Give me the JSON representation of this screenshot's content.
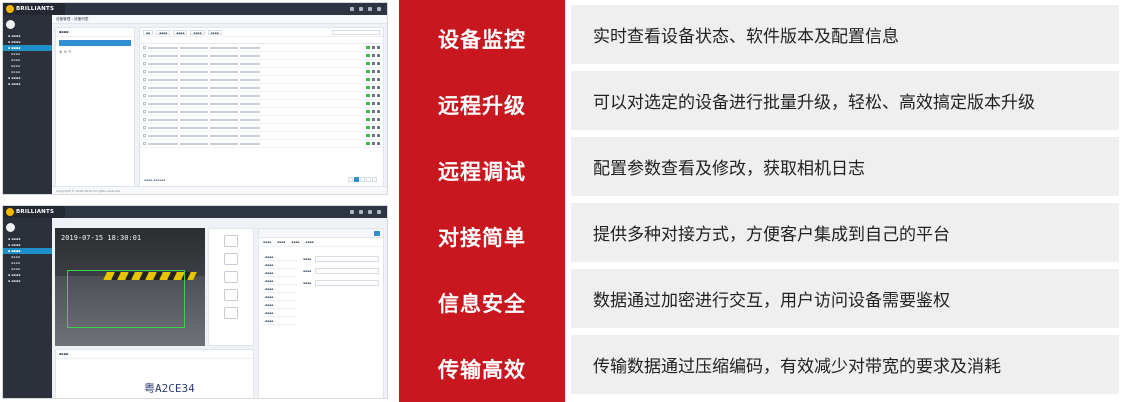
{
  "screenshot_top": {
    "brand": "BRILLIANTS",
    "breadcrumb": "设备管理 › 设备列表",
    "footer": "Copyright © 2018-2019 All rights reserved."
  },
  "screenshot_bottom": {
    "brand": "BRILLIANTS",
    "timestamp": "2019-07-15 18:30:01",
    "plate_number": "粤A2CE34"
  },
  "features": [
    {
      "title": "设备监控",
      "description": "实时查看设备状态、软件版本及配置信息"
    },
    {
      "title": "远程升级",
      "description": "可以对选定的设备进行批量升级，轻松、高效搞定版本升级"
    },
    {
      "title": "远程调试",
      "description": "配置参数查看及修改，获取相机日志"
    },
    {
      "title": "对接简单",
      "description": "提供多种对接方式，方便客户集成到自己的平台"
    },
    {
      "title": "信息安全",
      "description": "数据通过加密进行交互，用户访问设备需要鉴权"
    },
    {
      "title": "传输高效",
      "description": "传输数据通过压缩编码，有效减少对带宽的要求及消耗"
    }
  ],
  "colors": {
    "accent_red": "#c8171e",
    "row_bg": "#efefef",
    "brand_yellow": "#f5b800"
  }
}
